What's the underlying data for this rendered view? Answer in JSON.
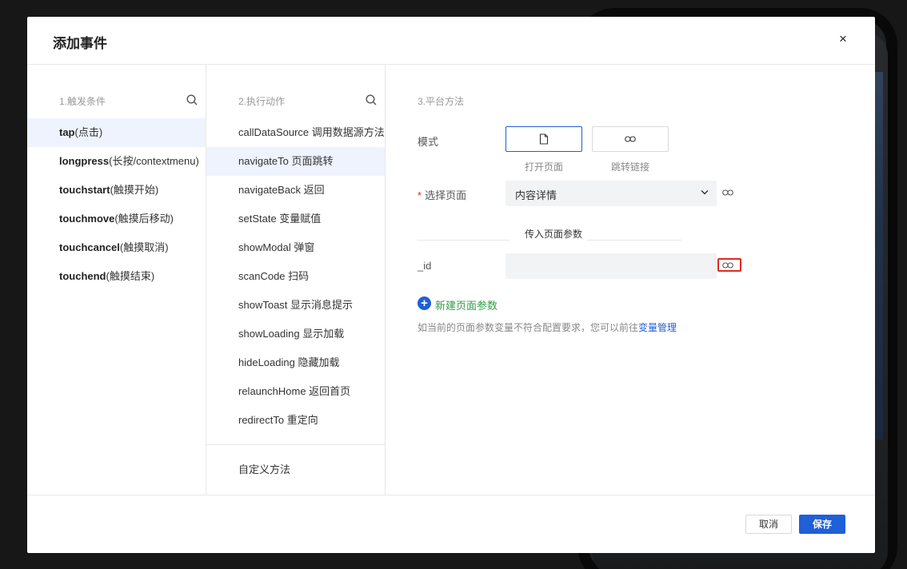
{
  "dialog": {
    "title": "添加事件",
    "close_label": "×"
  },
  "trigger": {
    "header": "1.触发条件",
    "items": [
      {
        "name": "tap",
        "desc": "(点击)",
        "active": true
      },
      {
        "name": "longpress",
        "desc": "(长按/contextmenu)",
        "active": false
      },
      {
        "name": "touchstart",
        "desc": "(触摸开始)",
        "active": false
      },
      {
        "name": "touchmove",
        "desc": "(触摸后移动)",
        "active": false
      },
      {
        "name": "touchcancel",
        "desc": "(触摸取消)",
        "active": false
      },
      {
        "name": "touchend",
        "desc": "(触摸结束)",
        "active": false
      }
    ]
  },
  "action": {
    "header": "2.执行动作",
    "items": [
      {
        "label": "callDataSource 调用数据源方法",
        "active": false
      },
      {
        "label": "navigateTo 页面跳转",
        "active": true
      },
      {
        "label": "navigateBack 返回",
        "active": false
      },
      {
        "label": "setState 变量赋值",
        "active": false
      },
      {
        "label": "showModal 弹窗",
        "active": false
      },
      {
        "label": "scanCode 扫码",
        "active": false
      },
      {
        "label": "showToast 显示消息提示",
        "active": false
      },
      {
        "label": "showLoading 显示加载",
        "active": false
      },
      {
        "label": "hideLoading 隐藏加载",
        "active": false
      },
      {
        "label": "relaunchHome 返回首页",
        "active": false
      },
      {
        "label": "redirectTo 重定向",
        "active": false
      }
    ],
    "custom_method": "自定义方法"
  },
  "platform": {
    "header": "3.平台方法",
    "mode_label": "模式",
    "mode_options": [
      {
        "caption": "打开页面",
        "icon": "page-icon",
        "selected": true
      },
      {
        "caption": "跳转链接",
        "icon": "link-icon",
        "selected": false
      }
    ],
    "required_mark": "*",
    "select_page_label": "选择页面",
    "select_page_value": "内容详情",
    "divider_text": "传入页面参数",
    "param_name": "_id",
    "param_value": "",
    "add_param_label": "新建页面参数",
    "hint_text": "如当前的页面参数变量不符合配置要求，您可以前往",
    "hint_link": "变量管理"
  },
  "footer": {
    "cancel_label": "取消",
    "save_label": "保存"
  },
  "colors": {
    "accent": "#1f5fd8",
    "active_row": "#eef3fd",
    "add_text": "#2f9e44",
    "highlight": "#e02a1f"
  }
}
